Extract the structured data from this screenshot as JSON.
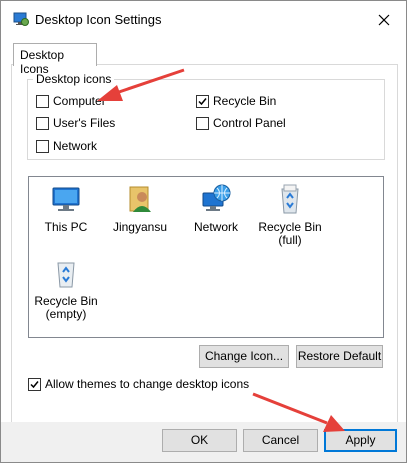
{
  "window": {
    "title": "Desktop Icon Settings"
  },
  "tabs": [
    {
      "label": "Desktop Icons"
    }
  ],
  "desktop_icons_group": {
    "legend": "Desktop icons",
    "checkboxes": [
      {
        "label": "Computer",
        "checked": false
      },
      {
        "label": "Recycle Bin",
        "checked": true
      },
      {
        "label": "User's Files",
        "checked": false
      },
      {
        "label": "Control Panel",
        "checked": false
      },
      {
        "label": "Network",
        "checked": false
      }
    ]
  },
  "icon_list": [
    {
      "label": "This PC",
      "icon": "computer-icon"
    },
    {
      "label": "Jingyansu",
      "icon": "user-folder-icon"
    },
    {
      "label": "Network",
      "icon": "network-icon"
    },
    {
      "label": "Recycle Bin (full)",
      "icon": "recycle-bin-full-icon"
    },
    {
      "label": "Recycle Bin (empty)",
      "icon": "recycle-bin-empty-icon"
    }
  ],
  "buttons": {
    "change_icon": "Change Icon...",
    "restore_default": "Restore Default",
    "ok": "OK",
    "cancel": "Cancel",
    "apply": "Apply"
  },
  "allow_themes": {
    "label": "Allow themes to change desktop icons",
    "checked": true
  },
  "colors": {
    "annotation_arrow": "#e5403a",
    "focus_border": "#0078d7"
  }
}
